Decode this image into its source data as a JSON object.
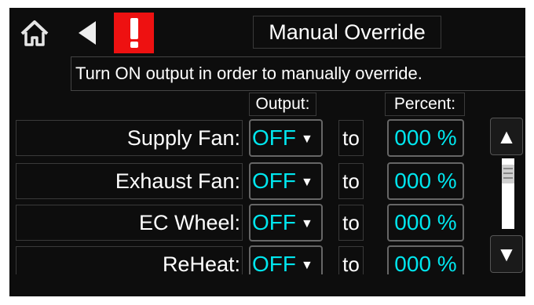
{
  "header": {
    "title": "Manual Override",
    "icons": {
      "home": "home-icon",
      "back": "back-arrow-icon",
      "alarm": "exclamation-icon"
    },
    "alarm_color": "#ee1111"
  },
  "instruction": "Turn ON output in order to manually override.",
  "columns": {
    "output": "Output:",
    "percent": "Percent:"
  },
  "rows": [
    {
      "label": "Supply Fan:",
      "output": "OFF",
      "to": "to",
      "percent": "000 %"
    },
    {
      "label": "Exhaust Fan:",
      "output": "OFF",
      "to": "to",
      "percent": "000 %"
    },
    {
      "label": "EC Wheel:",
      "output": "OFF",
      "to": "to",
      "percent": "000 %"
    },
    {
      "label": "ReHeat:",
      "output": "OFF",
      "to": "to",
      "percent": "000 %"
    }
  ],
  "scrollbar": {
    "up": "up-arrow-icon",
    "down": "down-arrow-icon"
  },
  "colors": {
    "value_text": "#00e6ee",
    "background": "#0d0d0d"
  }
}
